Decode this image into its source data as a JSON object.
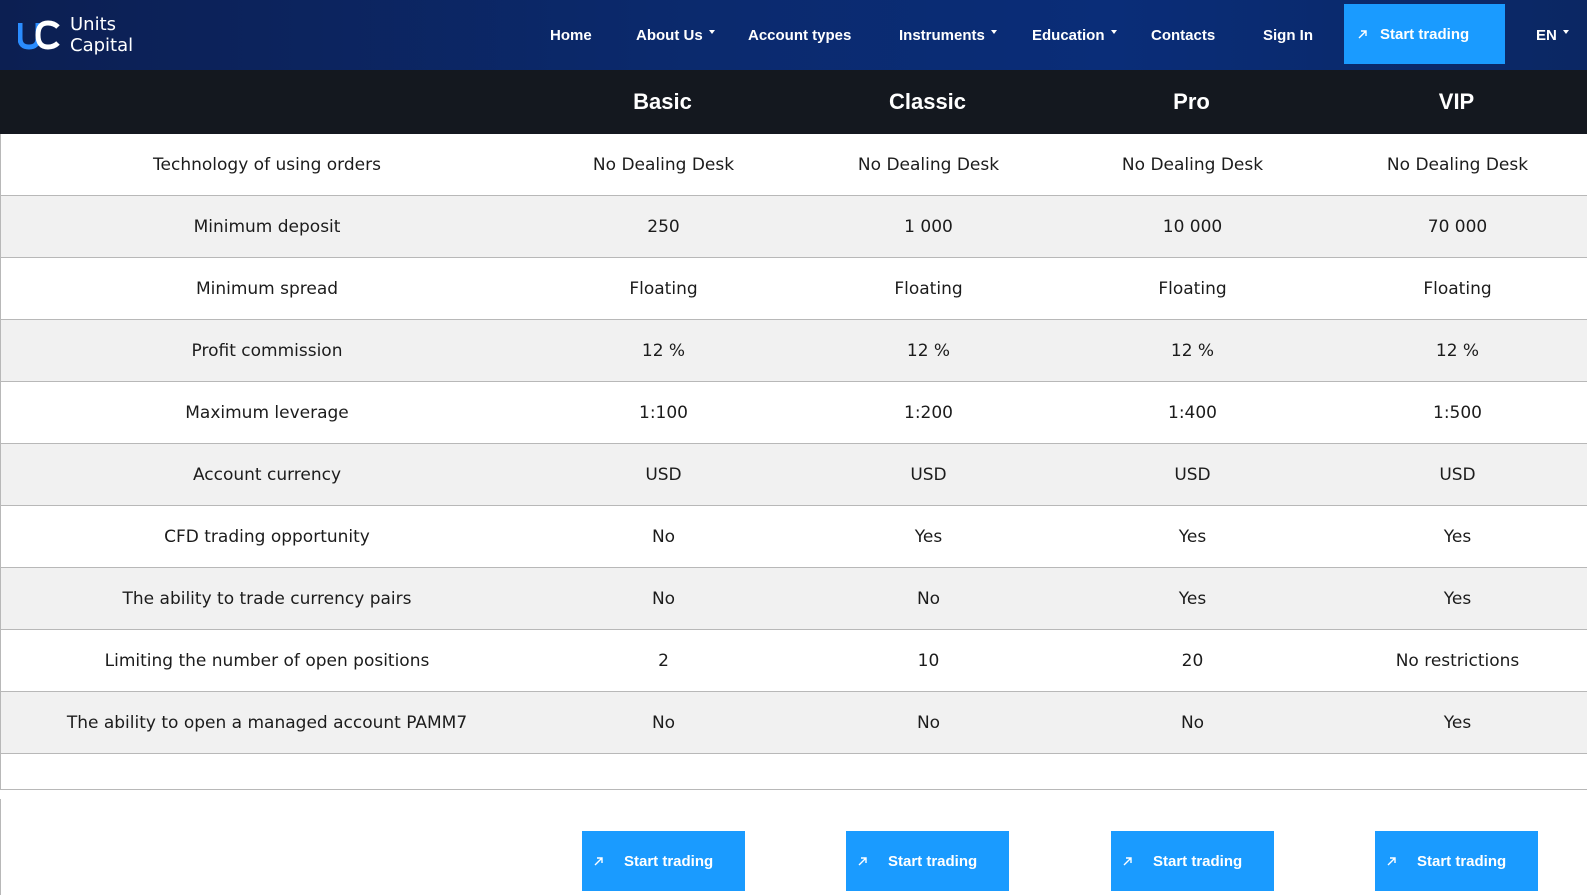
{
  "brand": {
    "line1": "Units",
    "line2": "Capital"
  },
  "nav": {
    "home": "Home",
    "about": "About Us",
    "account_types": "Account types",
    "instruments": "Instruments",
    "education": "Education",
    "contacts": "Contacts",
    "sign_in": "Sign In",
    "start_trading": "Start trading",
    "language": "EN"
  },
  "plans": [
    "Basic",
    "Classic",
    "Pro",
    "VIP"
  ],
  "rows": [
    {
      "label": "Technology of using orders",
      "values": [
        "No Dealing Desk",
        "No Dealing Desk",
        "No Dealing Desk",
        "No Dealing Desk"
      ]
    },
    {
      "label": "Minimum deposit",
      "values": [
        "250",
        "1 000",
        "10 000",
        "70 000"
      ]
    },
    {
      "label": "Minimum spread",
      "values": [
        "Floating",
        "Floating",
        "Floating",
        "Floating"
      ]
    },
    {
      "label": "Profit commission",
      "values": [
        "12 %",
        "12 %",
        "12 %",
        "12 %"
      ]
    },
    {
      "label": "Maximum leverage",
      "values": [
        "1:100",
        "1:200",
        "1:400",
        "1:500"
      ]
    },
    {
      "label": "Account currency",
      "values": [
        "USD",
        "USD",
        "USD",
        "USD"
      ]
    },
    {
      "label": "CFD trading opportunity",
      "values": [
        "No",
        "Yes",
        "Yes",
        "Yes"
      ]
    },
    {
      "label": "The ability to trade currency pairs",
      "values": [
        "No",
        "No",
        "Yes",
        "Yes"
      ]
    },
    {
      "label": "Limiting the number of open positions",
      "values": [
        "2",
        "10",
        "20",
        "No restrictions"
      ]
    },
    {
      "label": "The ability to open a managed account PAMM7",
      "values": [
        "No",
        "No",
        "No",
        "Yes"
      ]
    }
  ],
  "cta_label": "Start trading",
  "colors": {
    "header_bg": "#0b2a6e",
    "accent": "#1a9bff",
    "plan_head_bg": "#14181f",
    "row_alt": "#f1f1f1"
  },
  "icons": {
    "logo": "uc-logo-icon",
    "dropdown": "chevron-down-icon",
    "cta": "arrow-up-right-icon"
  }
}
